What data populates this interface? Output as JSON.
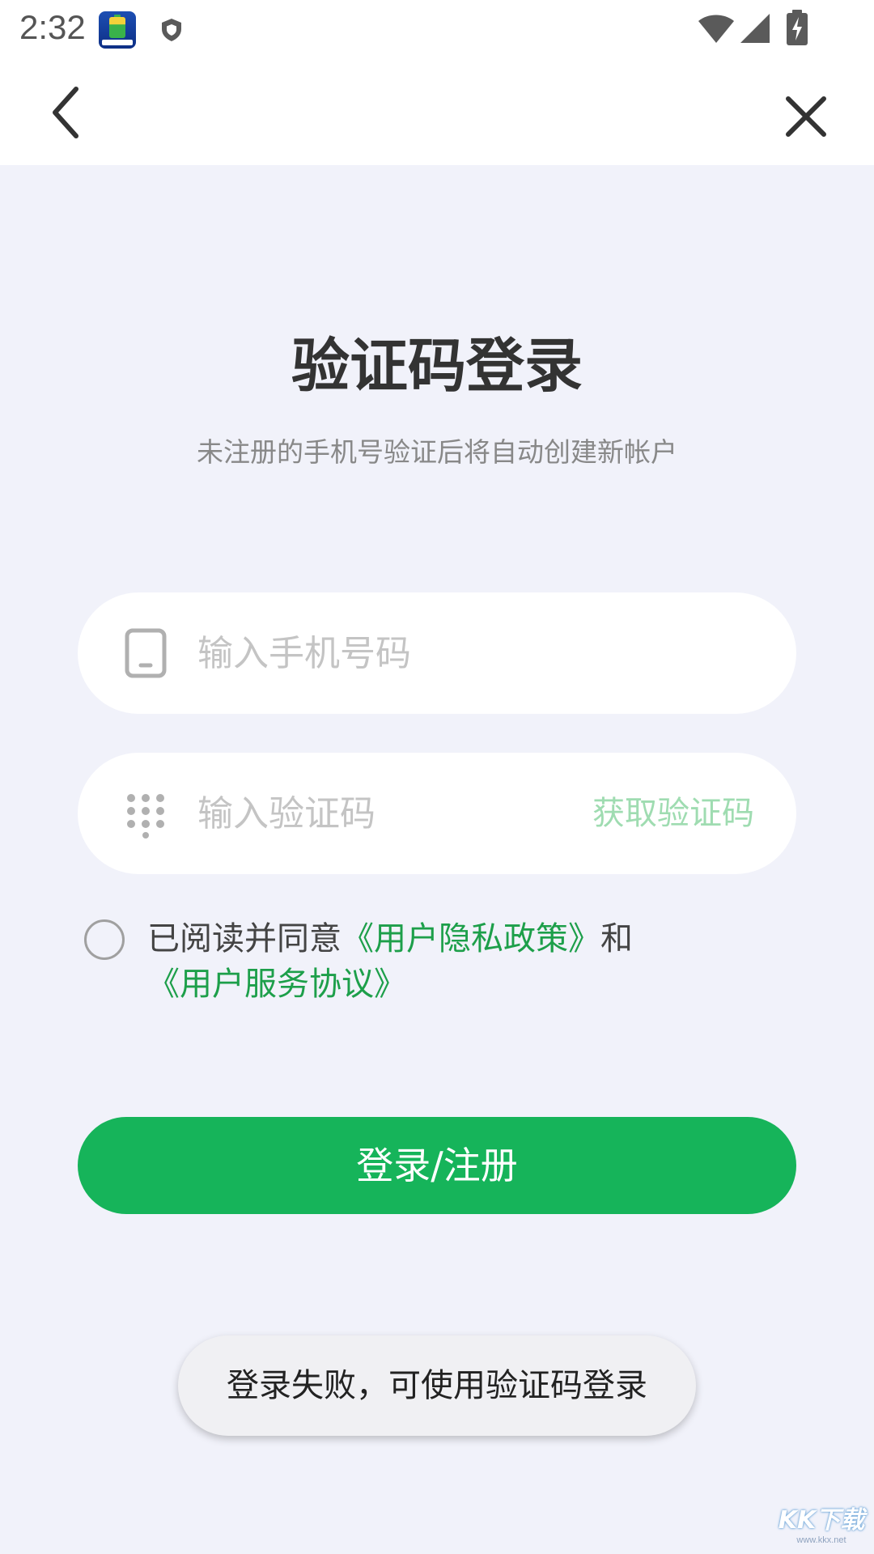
{
  "status_bar": {
    "time": "2:32"
  },
  "header": {
    "back_icon": "chevron-left-icon",
    "close_icon": "close-icon"
  },
  "title": "验证码登录",
  "subtitle": "未注册的手机号验证后将自动创建新帐户",
  "phone_field": {
    "icon": "phone-icon",
    "value": "",
    "placeholder": "输入手机号码"
  },
  "code_field": {
    "icon": "keypad-icon",
    "value": "",
    "placeholder": "输入验证码",
    "get_code_label": "获取验证码"
  },
  "agreement": {
    "checked": false,
    "prefix": "已阅读并同意",
    "privacy_link": "《用户隐私政策》",
    "conjunction": "和",
    "service_link": "《用户服务协议》"
  },
  "login_button_label": "登录/注册",
  "toast_message": "登录失败，可使用验证码登录",
  "watermark": {
    "logo": "KK下载",
    "url": "www.kkx.net"
  },
  "colors": {
    "accent": "#16b45a",
    "link": "#1d9f4a",
    "get_code_disabled": "#9fdcb1",
    "background": "#f1f2fa"
  }
}
